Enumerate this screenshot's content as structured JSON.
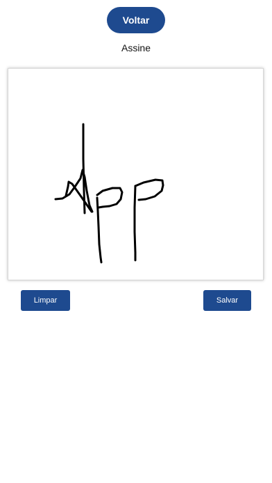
{
  "header": {
    "back_label": "Voltar",
    "title": "Assine"
  },
  "signature_pad": {
    "ink_color": "#000000"
  },
  "actions": {
    "clear_label": "Limpar",
    "save_label": "Salvar"
  },
  "colors": {
    "primary": "#1e4a8f",
    "background": "#ffffff"
  }
}
